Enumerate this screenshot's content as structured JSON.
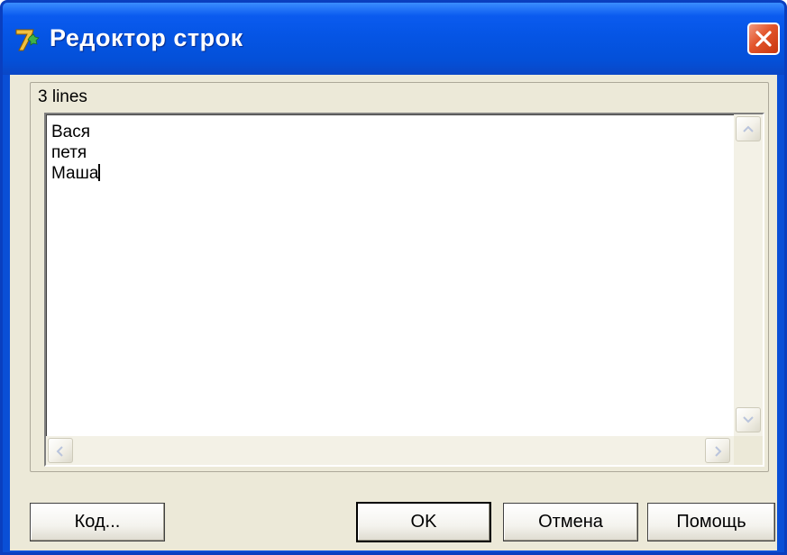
{
  "window": {
    "title": "Редоктор строк",
    "icon": "delphi-7-app-icon",
    "close_icon": "close-x-icon"
  },
  "editor": {
    "line_count_label": "3 lines",
    "lines": [
      "Вася",
      "петя",
      "Маша"
    ],
    "scroll_icons": {
      "up": "scroll-up-arrow-icon",
      "down": "scroll-down-arrow-icon",
      "left": "scroll-left-arrow-icon",
      "right": "scroll-right-arrow-icon"
    }
  },
  "buttons": {
    "code_label": "Код...",
    "ok_label": "OK",
    "cancel_label": "Отмена",
    "help_label": "Помощь"
  },
  "colors": {
    "titlebar": "#0555e5",
    "close_button": "#e2542a",
    "dialog_background": "#ece9d8"
  }
}
